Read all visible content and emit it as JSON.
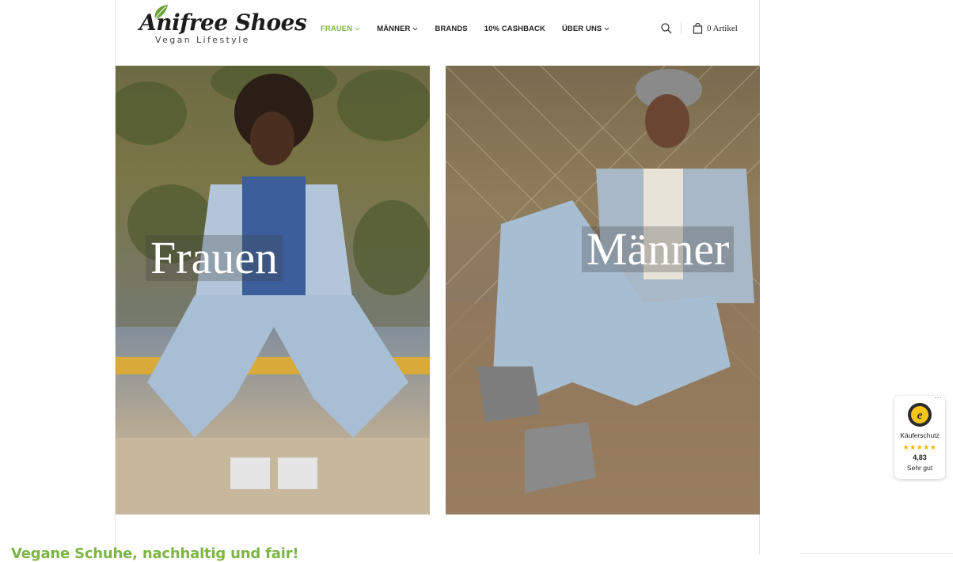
{
  "brand": {
    "name": "Anifree Shoes",
    "tagline": "Vegan Lifestyle",
    "accent_color": "#7db545"
  },
  "nav": {
    "items": [
      {
        "label": "FRAUEN",
        "dropdown": true,
        "active": true
      },
      {
        "label": "MÄNNER",
        "dropdown": true,
        "active": false
      },
      {
        "label": "BRANDS",
        "dropdown": false,
        "active": false
      },
      {
        "label": "10% CASHBACK",
        "dropdown": false,
        "active": false
      },
      {
        "label": "ÜBER UNS",
        "dropdown": true,
        "active": false
      }
    ]
  },
  "tools": {
    "search_icon": "search-icon",
    "cart_icon": "shopping-bag-icon",
    "cart_label": "0 Artikel"
  },
  "tiles": {
    "women": {
      "label": "Frauen"
    },
    "men": {
      "label": "Männer"
    }
  },
  "headline": "Vegane Schuhe, nachhaltig und fair!",
  "trust_badge": {
    "label": "Käuferschutz",
    "stars": "★★★★★",
    "score": "4,83",
    "rating_text": "Sehr gut",
    "more": "···"
  }
}
